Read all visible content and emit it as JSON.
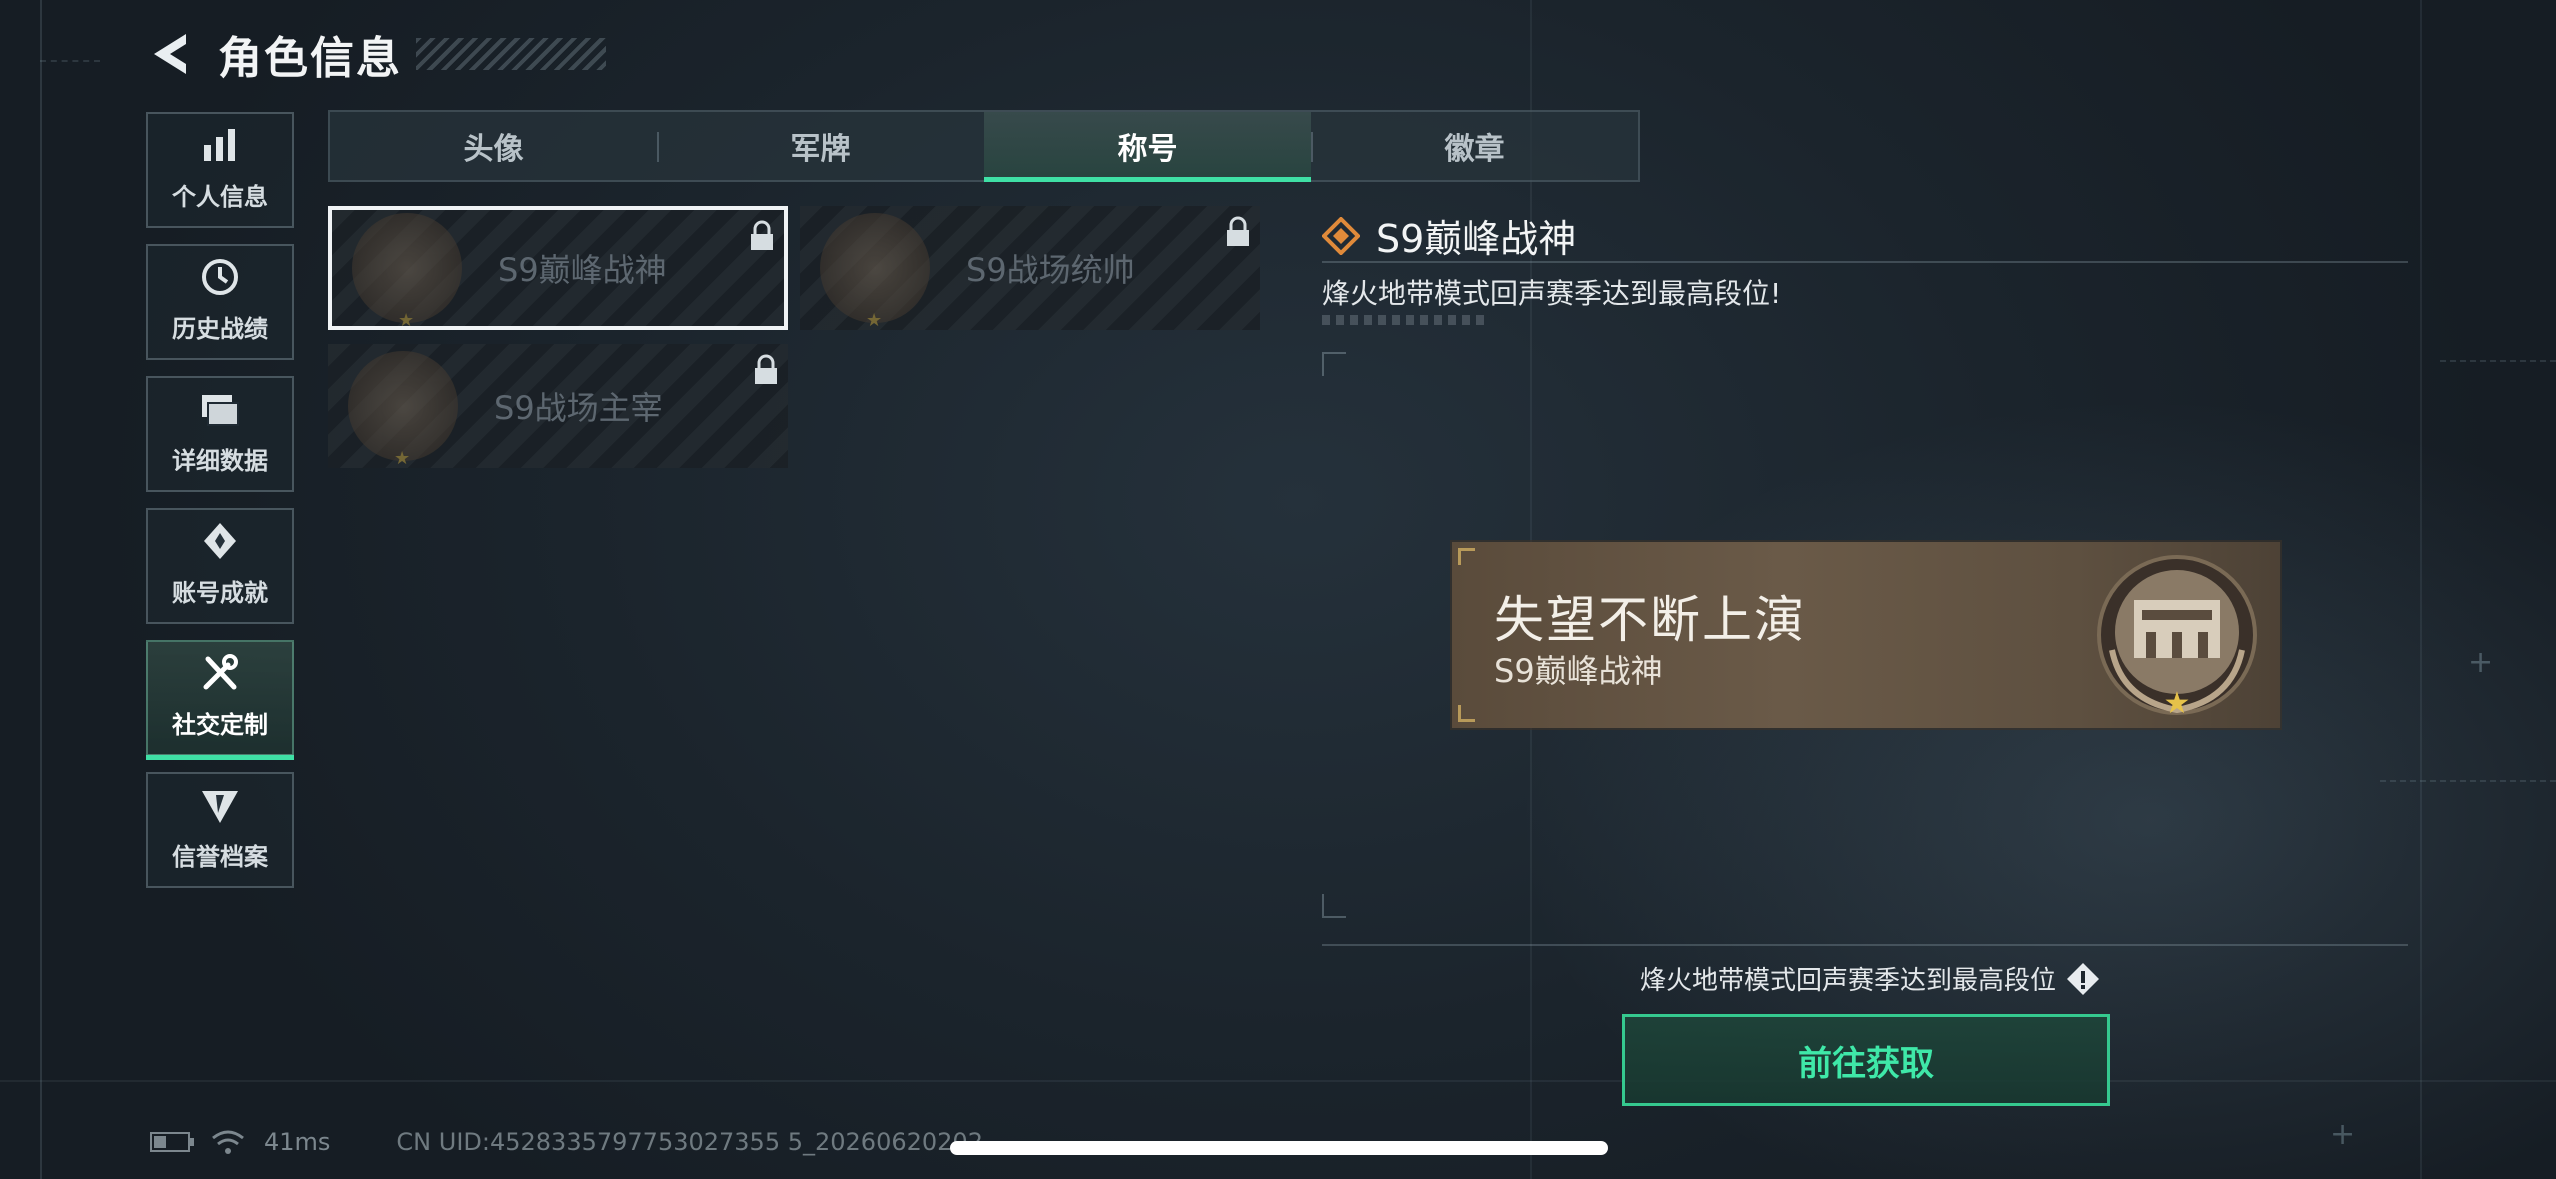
{
  "header": {
    "title": "角色信息"
  },
  "sidebar": {
    "items": [
      {
        "label": "个人信息"
      },
      {
        "label": "历史战绩"
      },
      {
        "label": "详细数据"
      },
      {
        "label": "账号成就"
      },
      {
        "label": "社交定制",
        "active": true
      },
      {
        "label": "信誉档案"
      }
    ]
  },
  "tabs": [
    {
      "label": "头像"
    },
    {
      "label": "军牌"
    },
    {
      "label": "称号",
      "active": true
    },
    {
      "label": "徽章"
    }
  ],
  "titles": [
    {
      "label": "S9巅峰战神",
      "selected": true,
      "locked": true
    },
    {
      "label": "S9战场统帅",
      "locked": true
    },
    {
      "label": "S9战场主宰",
      "locked": true
    }
  ],
  "detail": {
    "title": "S9巅峰战神",
    "description": "烽火地带模式回声赛季达到最高段位!",
    "banner_main": "失望不断上演",
    "banner_sub": "S9巅峰战神",
    "acquire_text": "烽火地带模式回声赛季达到最高段位",
    "goto_label": "前往获取"
  },
  "status": {
    "ping": "41ms",
    "uid": "CN UID:4528335797753027355 5_20260620202"
  },
  "colors": {
    "accent": "#3fe0a5",
    "banner": "#6a5a48",
    "background": "#1b242c"
  }
}
